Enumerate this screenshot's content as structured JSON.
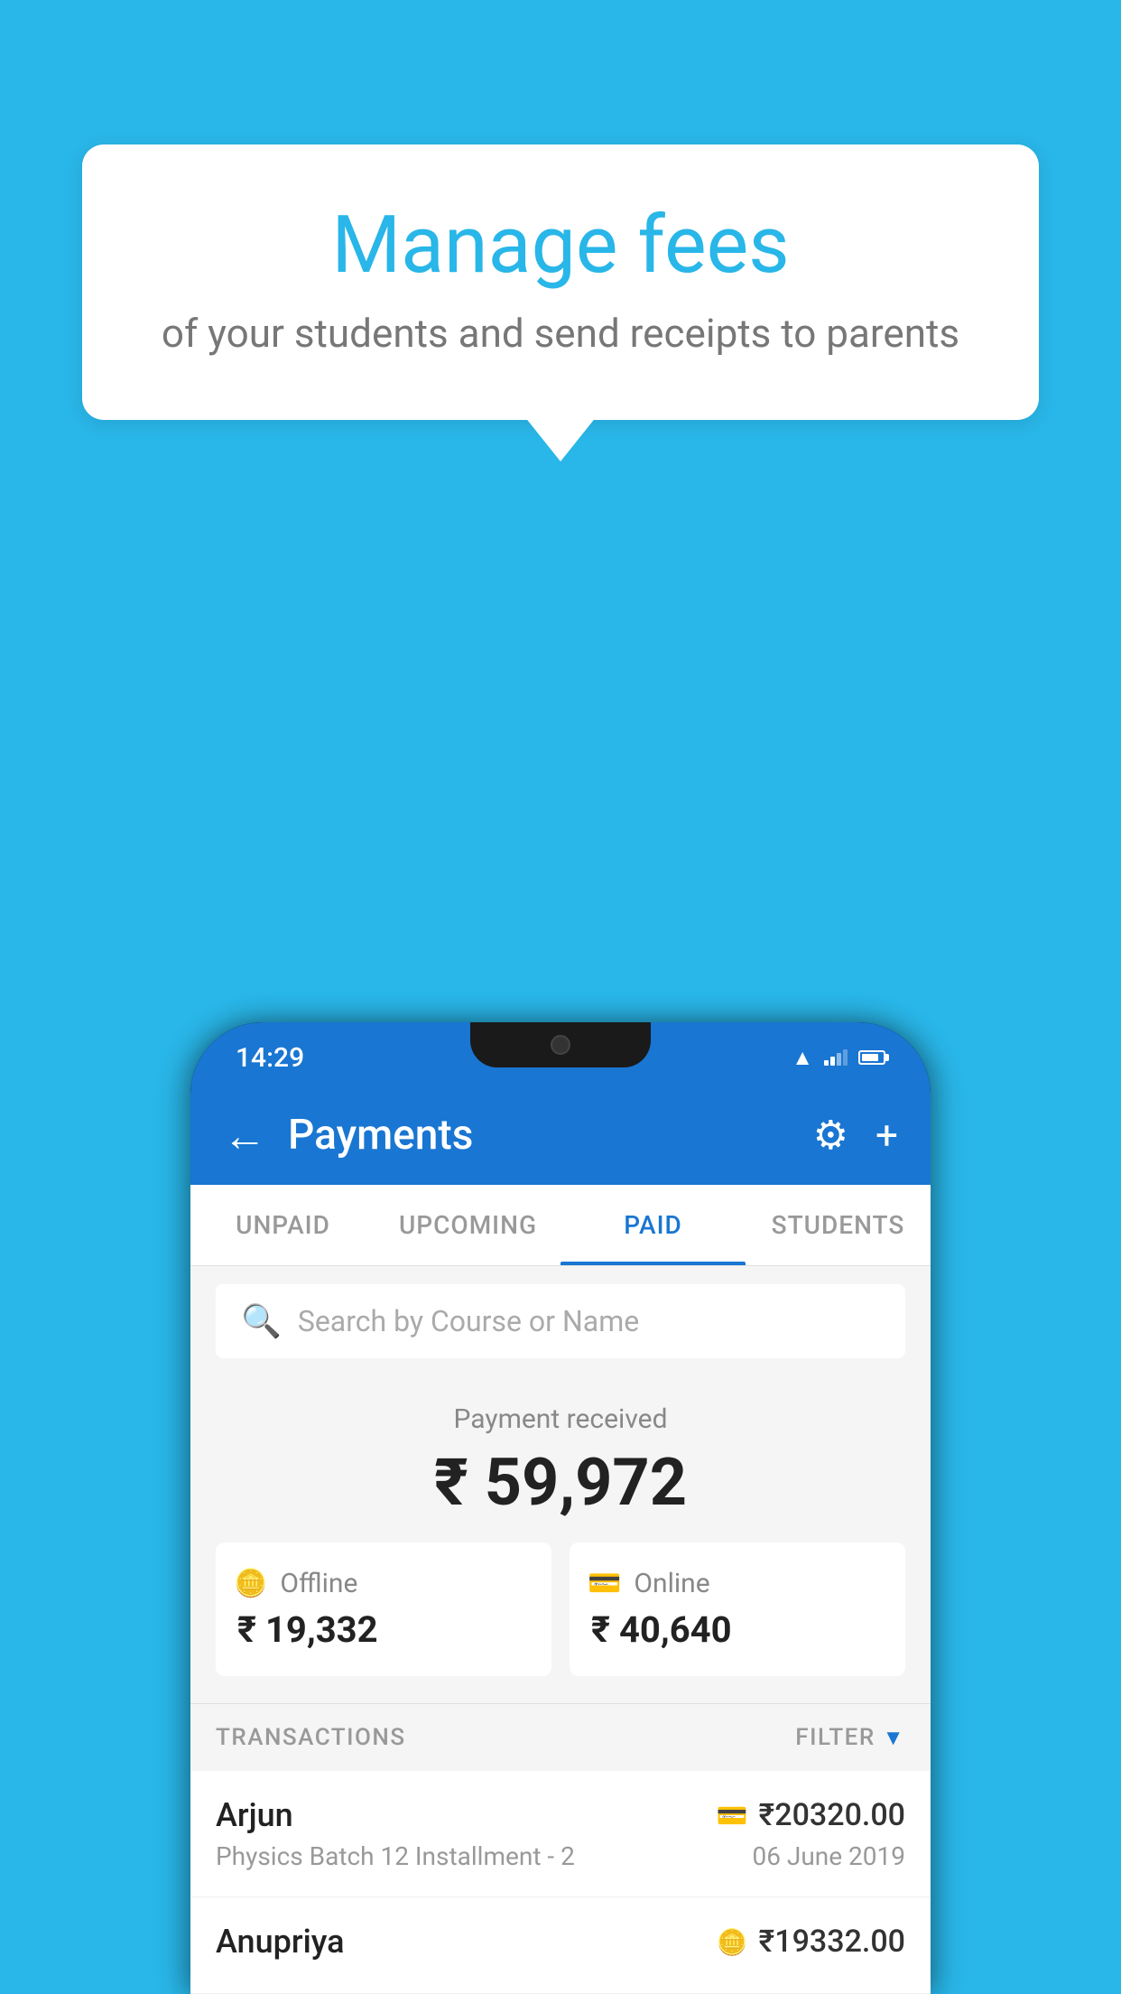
{
  "background_color": "#29b6e8",
  "speech_bubble": {
    "title": "Manage fees",
    "subtitle": "of your students and send receipts to parents"
  },
  "phone": {
    "status_bar": {
      "time": "14:29"
    },
    "app_bar": {
      "title": "Payments",
      "back_icon": "←",
      "settings_icon": "⚙",
      "add_icon": "+"
    },
    "tabs": [
      {
        "label": "UNPAID",
        "active": false
      },
      {
        "label": "UPCOMING",
        "active": false
      },
      {
        "label": "PAID",
        "active": true
      },
      {
        "label": "STUDENTS",
        "active": false
      }
    ],
    "search": {
      "placeholder": "Search by Course or Name"
    },
    "payment": {
      "label": "Payment received",
      "amount": "₹ 59,972",
      "offline": {
        "label": "Offline",
        "amount": "₹ 19,332"
      },
      "online": {
        "label": "Online",
        "amount": "₹ 40,640"
      }
    },
    "transactions": {
      "header_label": "TRANSACTIONS",
      "filter_label": "FILTER",
      "items": [
        {
          "name": "Arjun",
          "course": "Physics Batch 12 Installment - 2",
          "amount": "₹20320.00",
          "date": "06 June 2019",
          "method": "card"
        },
        {
          "name": "Anupriya",
          "course": "",
          "amount": "₹19332.00",
          "date": "",
          "method": "cash"
        }
      ]
    }
  }
}
